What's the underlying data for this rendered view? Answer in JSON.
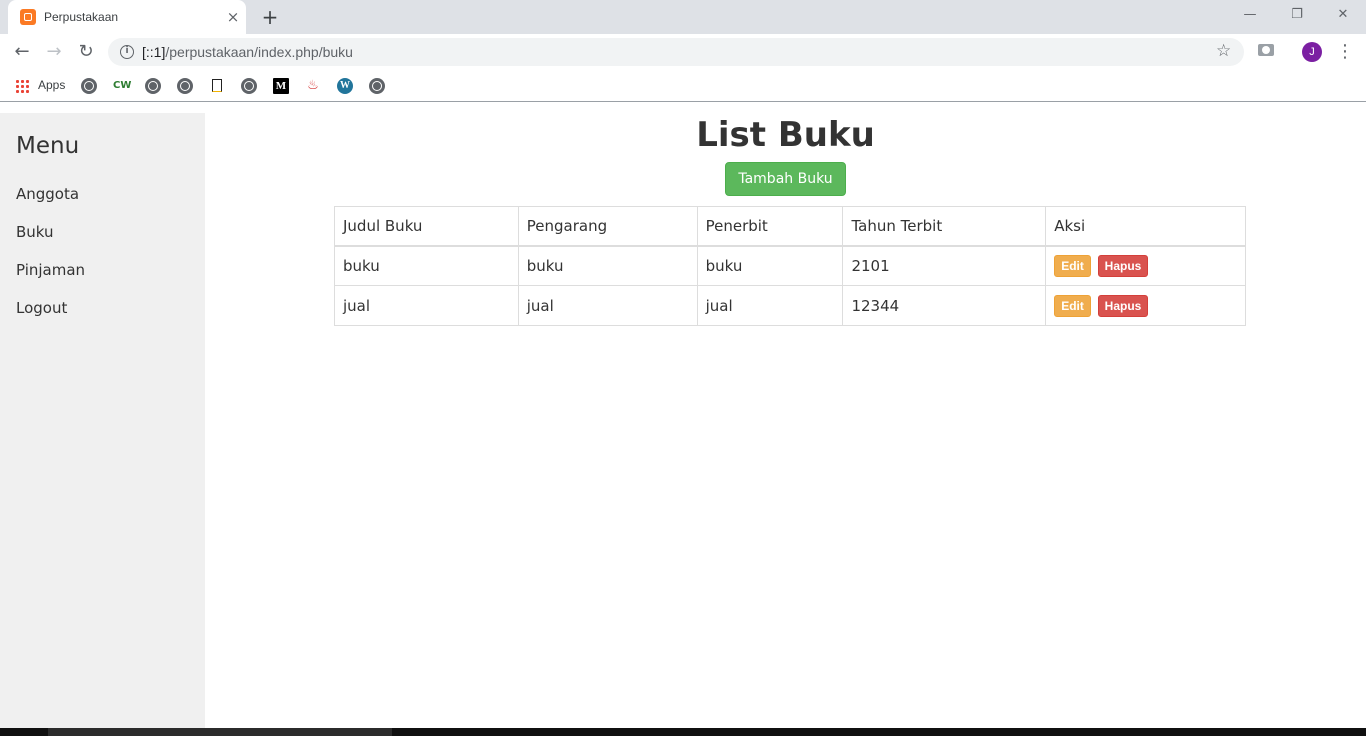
{
  "browser": {
    "tab_title": "Perpustakaan",
    "tab_close": "×",
    "new_tab": "+",
    "url_host": "[::1]",
    "url_path": "/perpustakaan/index.php/buku",
    "avatar_initial": "J",
    "bookmarks_apps_label": "Apps",
    "bookmark_cw": "CW",
    "bookmark_medium": "M",
    "window_controls": {
      "minimize": "—",
      "restore": "❐",
      "close": "✕"
    }
  },
  "sidebar": {
    "title": "Menu",
    "items": [
      {
        "label": "Anggota"
      },
      {
        "label": "Buku"
      },
      {
        "label": "Pinjaman"
      },
      {
        "label": "Logout"
      }
    ]
  },
  "main": {
    "title": "List Buku",
    "add_button": "Tambah Buku",
    "table": {
      "headers": [
        "Judul Buku",
        "Pengarang",
        "Penerbit",
        "Tahun Terbit",
        "Aksi"
      ],
      "rows": [
        {
          "judul": "buku",
          "pengarang": "buku",
          "penerbit": "buku",
          "tahun": "2101",
          "edit": "Edit",
          "hapus": "Hapus"
        },
        {
          "judul": "jual",
          "pengarang": "jual",
          "penerbit": "jual",
          "tahun": "12344",
          "edit": "Edit",
          "hapus": "Hapus"
        }
      ]
    }
  },
  "colors": {
    "success": "#5cb85c",
    "warning": "#f0ad4e",
    "danger": "#d9534f",
    "sidebar_bg": "#f0f0f0"
  }
}
